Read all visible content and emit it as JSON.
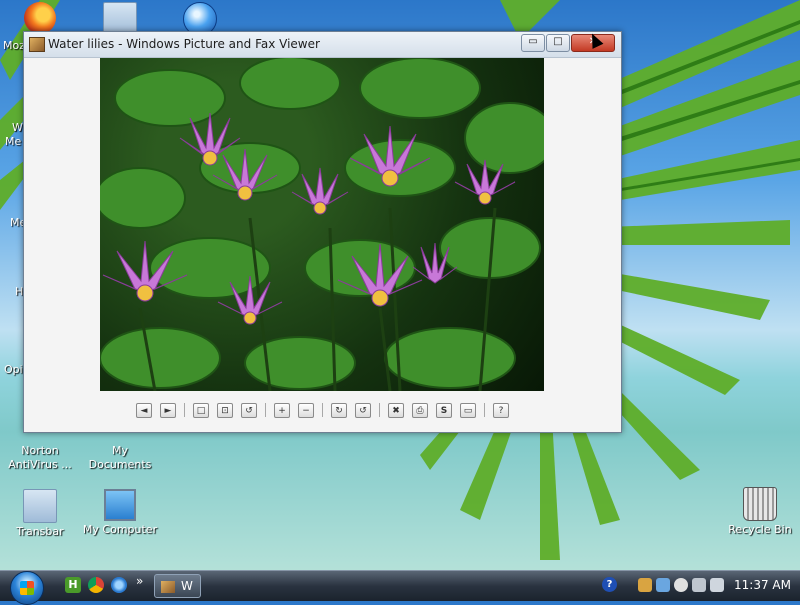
{
  "desktop": {
    "icons": [
      {
        "label": ""
      },
      {
        "label": ""
      },
      {
        "label": ""
      },
      {
        "label": "Norton AntiVirus ..."
      },
      {
        "label": "My Documents"
      },
      {
        "label": "Transbar"
      },
      {
        "label": "My Computer"
      },
      {
        "label": "Recycle Bin"
      }
    ],
    "fragments": [
      "Moz",
      "W",
      "Me",
      "Me",
      "H",
      "Opi"
    ]
  },
  "window": {
    "title": "Water lilies - Windows Picture and Fax Viewer",
    "controls": {
      "minimize": "▭",
      "maximize": "□",
      "close": "✕"
    }
  },
  "toolbar": {
    "buttons": [
      "◄",
      "►",
      "□",
      "⊡",
      "↺",
      "+",
      "−",
      "↻",
      "↺",
      "✖",
      "⎙",
      "S",
      "▭",
      "?"
    ]
  },
  "taskbar": {
    "quicklaunch_h": "H",
    "more": "»",
    "task_label": "W",
    "help": "?",
    "clock": "11:37 AM"
  },
  "colors": {
    "accent": "#2b83d8",
    "close": "#c33a24"
  }
}
